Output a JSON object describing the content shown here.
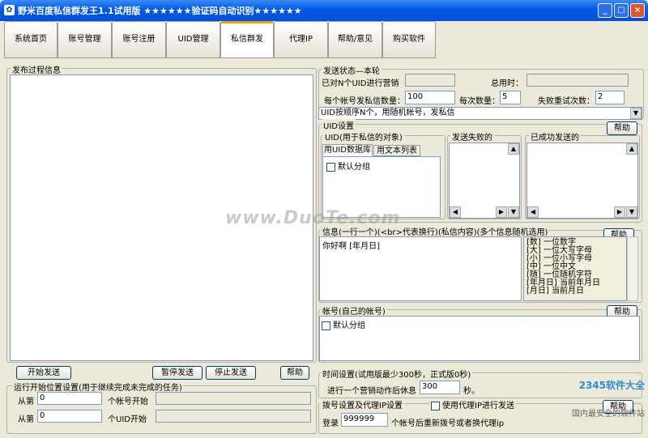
{
  "window": {
    "title": "野米百度私信群发王1.1试用版 ★★★★★★验证码自动识别★★★★★★",
    "min": "_",
    "max": "□",
    "close": "×"
  },
  "tabs": [
    {
      "label": "系统首页"
    },
    {
      "label": "账号管理"
    },
    {
      "label": "账号注册"
    },
    {
      "label": "UID管理"
    },
    {
      "label": "私信群发"
    },
    {
      "label": "代理IP"
    },
    {
      "label": "帮助/意见"
    },
    {
      "label": "购买软件"
    }
  ],
  "left": {
    "log_title": "发布过程信息",
    "start_btn": "开始发送",
    "pause_btn": "暂停发送",
    "stop_btn": "停止发送",
    "help_btn": "帮助",
    "resume": {
      "title": "运行开始位置设置(用于继续完成未完成的任务)",
      "from1": "从第",
      "value1": "0",
      "suffix1": "个帐号开始",
      "from2": "从第",
      "value2": "0",
      "suffix2": "个UID开始"
    }
  },
  "status": {
    "title": "发送状态—本轮",
    "marketed": "已对N个UID进行营销",
    "total_time": "总用时：",
    "per_account_label": "每个帐号发私信数量：",
    "per_account": "100",
    "each_label": "每次数量：",
    "each": "5",
    "retry_label": "失败重试次数：",
    "retry": "2",
    "order_select": "UID按顺序N个，用随机帐号，发私信"
  },
  "uid": {
    "title": "UID设置",
    "help": "帮助",
    "target_title": "UID(用于私信的对象)",
    "tab_db": "用UID数据库",
    "tab_text": "用文本列表",
    "default_group": "默认分组",
    "failed_title": "发送失败的",
    "success_title": "已成功发送的"
  },
  "message": {
    "title": "信息(一行一个)(<br>代表换行)(私信内容)(多个信息随机选用)",
    "help": "帮助",
    "content": "你好啊 [年月日]",
    "hints": [
      "[数] 一位数字",
      "[大] 一位大写字母",
      "[小] 一位小写字母",
      "[中] 一位中文",
      "[随] 一位随机字符",
      "[年月日] 当前年月日",
      "[月日]  当前月日"
    ]
  },
  "accounts": {
    "title": "帐号(自己的帐号)",
    "help": "帮助",
    "default_group": "默认分组"
  },
  "time": {
    "title": "时间设置(试用版最少300秒，正式版0秒)",
    "label": "进行一个营销动作后休息",
    "value": "300",
    "unit": "秒。"
  },
  "dial": {
    "title": "拨号设置及代理IP设置",
    "proxy_check": "使用代理IP进行发送",
    "help": "帮助",
    "login_label": "登录",
    "login_value": "999999",
    "login_suffix": "个帐号后重新拨号或者换代理ip"
  },
  "overlay": {
    "watermark": "www.DuoTe.com",
    "logo": "2345软件大全",
    "logo_sub": "国内最安全的软件站"
  }
}
